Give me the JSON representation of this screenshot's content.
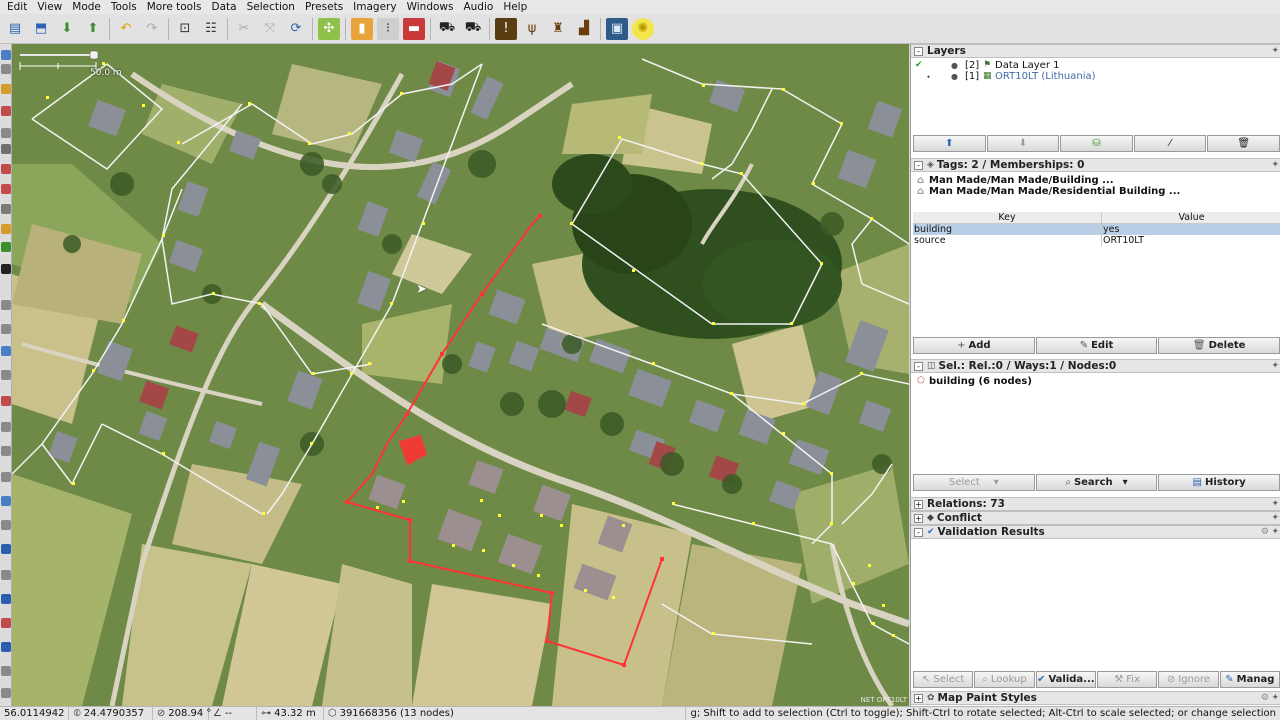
{
  "menu": [
    "Edit",
    "View",
    "Mode",
    "Tools",
    "More tools",
    "Data",
    "Selection",
    "Presets",
    "Imagery",
    "Windows",
    "Audio",
    "Help"
  ],
  "toolbar_icons": [
    "open-icon",
    "save-icon",
    "upload-icon",
    "undo-icon",
    "redo-icon",
    "zoom-icon",
    "preferences-icon",
    "update-data-icon",
    "wireframe-icon",
    "pin-icon",
    "traffic-light-icon",
    "building-icon",
    "car-icon",
    "car-front-icon",
    "warning-icon",
    "fork-icon",
    "castle-icon",
    "chart-icon",
    "square-icon",
    "sun-icon"
  ],
  "map": {
    "scale_label": "50.0 m",
    "attribution": "NET ORT10LT"
  },
  "layers": {
    "title": "Layers",
    "items": [
      {
        "index": "[2]",
        "name": "Data Layer 1"
      },
      {
        "index": "[1]",
        "name": "ORT10LT (Lithuania)"
      }
    ]
  },
  "tags": {
    "title": "Tags: 2 / Memberships: 0",
    "presets": [
      "Man Made/Man Made/Building ...",
      "Man Made/Man Made/Residential Building ..."
    ],
    "col_key": "Key",
    "col_value": "Value",
    "rows": [
      {
        "key": "building",
        "value": "yes"
      },
      {
        "key": "source",
        "value": "ORT10LT"
      }
    ],
    "add_label": "Add",
    "edit_label": "Edit",
    "delete_label": "Delete"
  },
  "selection": {
    "title": "Sel.: Rel.:0 / Ways:1 / Nodes:0",
    "items": [
      "building (6 nodes)"
    ],
    "select_label": "Select",
    "search_label": "Search",
    "history_label": "History"
  },
  "relations": {
    "title": "Relations: 73"
  },
  "conflict": {
    "title": "Conflict"
  },
  "validation": {
    "title": "Validation Results",
    "select_label": "Select",
    "lookup_label": "Lookup",
    "validate_label": "Valida...",
    "fix_label": "Fix",
    "ignore_label": "Ignore",
    "manage_label": "Manag"
  },
  "map_paint": {
    "title": "Map Paint Styles"
  },
  "status": {
    "lat": "56.0114942",
    "lon": "24.4790357",
    "heading": "208.94 °",
    "angle": "--",
    "distance": "43.32 m",
    "object": "391668356 (13 nodes)",
    "help": "g; Shift to add to selection (Ctrl to toggle); Shift-Ctrl to rotate selected; Alt-Ctrl to scale selected; or change selection"
  },
  "colors": {
    "selection_red": "#ff3333",
    "way_white": "#f2f2f2",
    "node_yellow": "#ffff33",
    "panel_header": "#e6e6e6",
    "selected_row": "#b8cfe5"
  }
}
